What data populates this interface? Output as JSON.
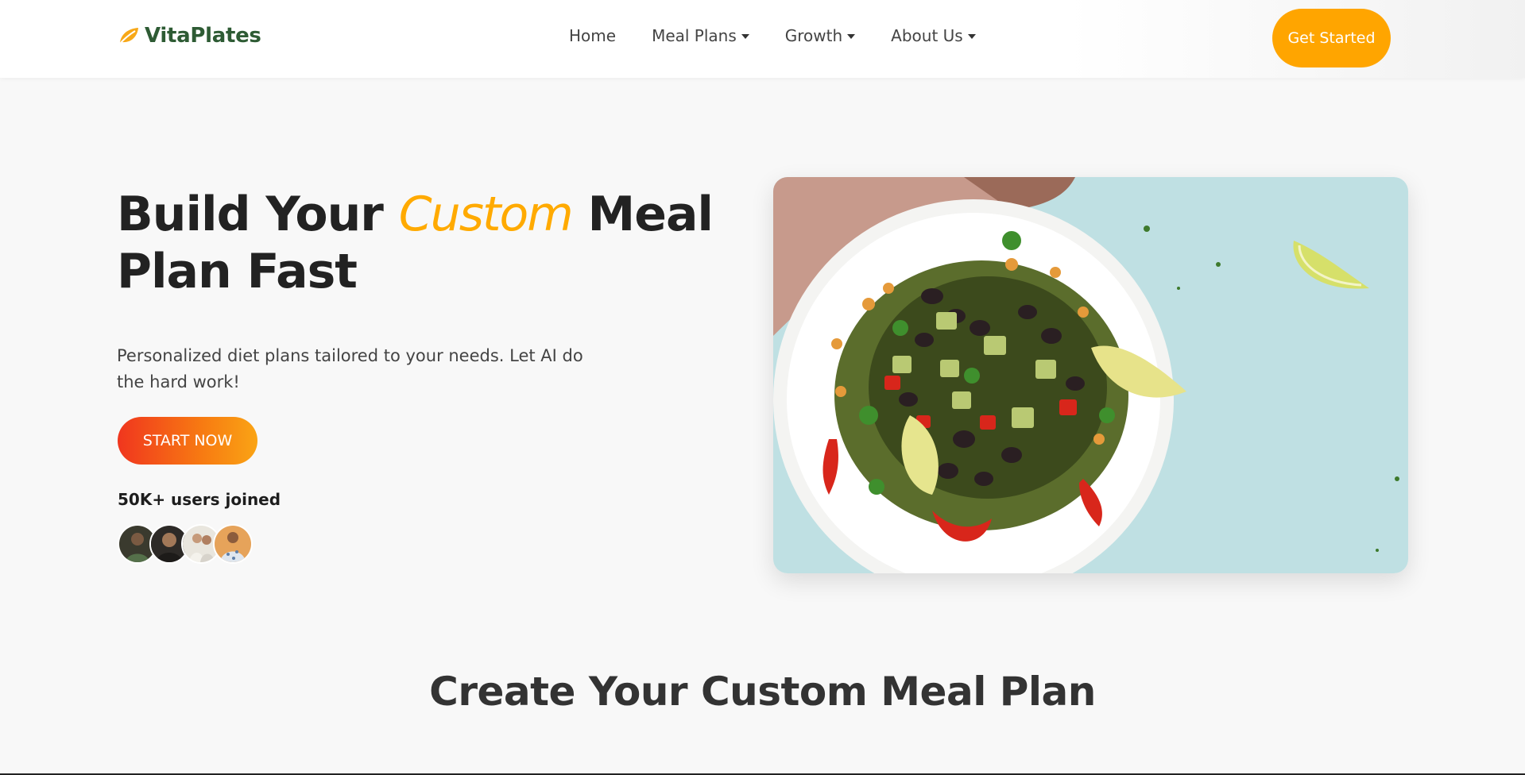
{
  "brand": {
    "name": "VitaPlates",
    "icon": "leaf-icon",
    "color": "#2e5b34"
  },
  "nav": {
    "items": [
      {
        "label": "Home",
        "dropdown": false
      },
      {
        "label": "Meal Plans",
        "dropdown": true
      },
      {
        "label": "Growth",
        "dropdown": true
      },
      {
        "label": "About Us",
        "dropdown": true
      }
    ],
    "cta_label": "Get Started",
    "cta_color": "#ffa500"
  },
  "hero": {
    "title_part1": "Build Your ",
    "title_accent": "Custom",
    "title_part2": " Meal Plan Fast",
    "accent_color": "#ffaa00",
    "subtitle": "Personalized diet plans tailored to your needs. Let AI do the hard work!",
    "start_label": "START NOW",
    "users_joined": "50K+ users joined"
  },
  "section": {
    "title": "Create Your Custom Meal Plan"
  }
}
